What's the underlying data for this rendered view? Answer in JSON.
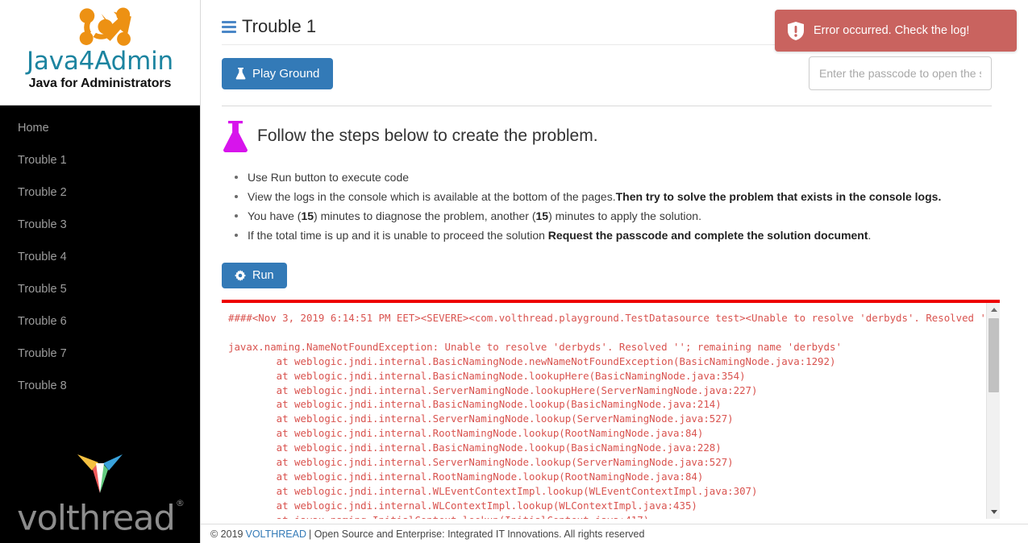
{
  "brand": {
    "logo_icon": "network-molecule-icon",
    "title": "Java4Admin",
    "subtitle": "Java for Administrators",
    "accent_color": "#1c84a0",
    "mark_color": "#ed9113"
  },
  "sidebar": {
    "background": "#000000",
    "items": [
      {
        "label": "Home"
      },
      {
        "label": "Trouble 1"
      },
      {
        "label": "Trouble 2"
      },
      {
        "label": "Trouble 3"
      },
      {
        "label": "Trouble 4"
      },
      {
        "label": "Trouble 5"
      },
      {
        "label": "Trouble 6"
      },
      {
        "label": "Trouble 7"
      },
      {
        "label": "Trouble 8"
      }
    ],
    "footer_logo": {
      "icon": "volthread-arrow-icon",
      "word": "volthread",
      "registered": "®"
    }
  },
  "header": {
    "menu_icon": "hamburger-icon",
    "title": "Trouble 1"
  },
  "toolbar": {
    "play_ground_label": "Play Ground",
    "play_ground_icon": "flask-icon",
    "passcode_placeholder": "Enter the passcode to open the solution document",
    "passcode_value": ""
  },
  "toast": {
    "icon": "shield-exclamation-icon",
    "message": "Error occurred. Check the log!",
    "color": "#c9635f"
  },
  "steps": {
    "heading_icon": "flask-icon",
    "heading_color": "#d714ec",
    "heading": "Follow the steps below to create the problem.",
    "items": [
      {
        "text": "Use Run button to execute code",
        "bold": ""
      },
      {
        "text": "View the logs in the console which is available at the bottom of the pages.",
        "bold": "Then try to solve the problem that exists in the console logs.",
        "tail": ""
      },
      {
        "pre": "You have (",
        "b1": "15",
        "mid": ") minutes to diagnose the problem, another (",
        "b2": "15",
        "post": ") minutes to apply the solution."
      },
      {
        "text": "If the total time is up and it is unable to proceed the solution ",
        "bold": "Request the passcode and complete the solution document",
        "tail": "."
      }
    ]
  },
  "run": {
    "label": "Run",
    "icon": "gear-icon"
  },
  "console": {
    "separator_color": "#ee0000",
    "text_color": "#d9534f",
    "log": "####<Nov 3, 2019 6:14:51 PM EET><SEVERE><com.volthread.playground.TestDatasource test><Unable to resolve 'derbyds'. Resolved ''\n\njavax.naming.NameNotFoundException: Unable to resolve 'derbyds'. Resolved ''; remaining name 'derbyds'\n        at weblogic.jndi.internal.BasicNamingNode.newNameNotFoundException(BasicNamingNode.java:1292)\n        at weblogic.jndi.internal.BasicNamingNode.lookupHere(BasicNamingNode.java:354)\n        at weblogic.jndi.internal.ServerNamingNode.lookupHere(ServerNamingNode.java:227)\n        at weblogic.jndi.internal.BasicNamingNode.lookup(BasicNamingNode.java:214)\n        at weblogic.jndi.internal.ServerNamingNode.lookup(ServerNamingNode.java:527)\n        at weblogic.jndi.internal.RootNamingNode.lookup(RootNamingNode.java:84)\n        at weblogic.jndi.internal.BasicNamingNode.lookup(BasicNamingNode.java:228)\n        at weblogic.jndi.internal.ServerNamingNode.lookup(ServerNamingNode.java:527)\n        at weblogic.jndi.internal.RootNamingNode.lookup(RootNamingNode.java:84)\n        at weblogic.jndi.internal.WLEventContextImpl.lookup(WLEventContextImpl.java:307)\n        at weblogic.jndi.internal.WLContextImpl.lookup(WLContextImpl.java:435)\n        at javax.naming.InitialContext.lookup(InitialContext.java:417)",
    "scrollbar": {
      "up_icon": "caret-up-icon",
      "down_icon": "caret-down-icon"
    }
  },
  "footer": {
    "copyright": "© 2019",
    "link": "VOLTHREAD",
    "rest": "| Open Source and Enterprise: Integrated IT Innovations. All rights reserved"
  }
}
